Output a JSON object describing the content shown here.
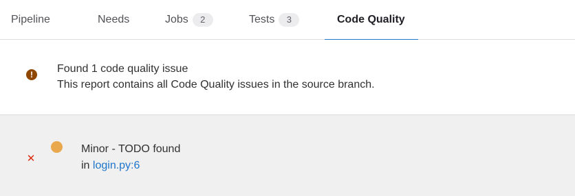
{
  "tabs": [
    {
      "label": "Pipeline",
      "count": null,
      "active": false
    },
    {
      "label": "Needs",
      "count": null,
      "active": false
    },
    {
      "label": "Jobs",
      "count": "2",
      "active": false
    },
    {
      "label": "Tests",
      "count": "3",
      "active": false
    },
    {
      "label": "Code Quality",
      "count": null,
      "active": true
    }
  ],
  "summary": {
    "icon": "warning-icon",
    "title": "Found 1 code quality issue",
    "description": "This report contains all Code Quality issues in the source branch."
  },
  "issue": {
    "status_icon": "close-icon",
    "severity_icon": "severity-dot-icon",
    "title": "Minor - TODO found",
    "location_prefix": "in",
    "location_link": "login.py:6"
  },
  "colors": {
    "active_tab_underline": "#1f75cb",
    "warning_icon": "#8f4700",
    "severity_minor": "#e9a84d",
    "failed_x": "#dd2b0e",
    "link": "#1f75cb",
    "issue_background": "#f0f0f0"
  }
}
